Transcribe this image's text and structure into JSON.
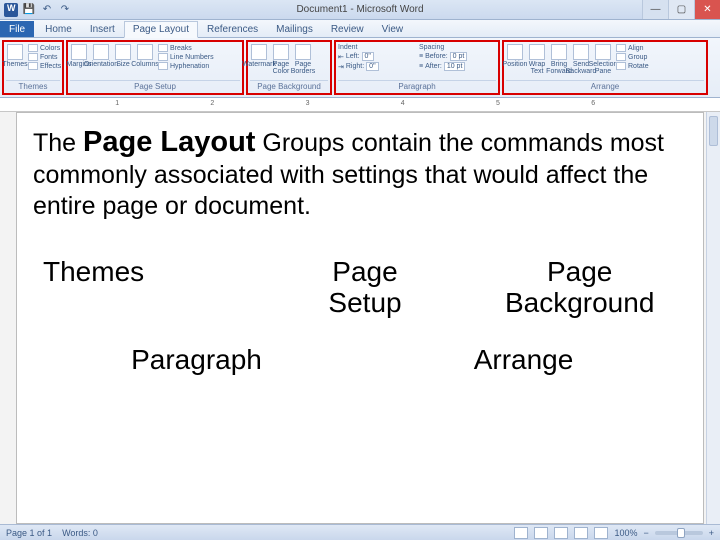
{
  "app": {
    "title": "Document1 - Microsoft Word"
  },
  "tabs": {
    "file": "File",
    "items": [
      "Home",
      "Insert",
      "Page Layout",
      "References",
      "Mailings",
      "Review",
      "View"
    ],
    "active": "Page Layout"
  },
  "ribbon": {
    "themes": {
      "name": "Themes",
      "main": "Themes",
      "colors": "Colors",
      "fonts": "Fonts",
      "effects": "Effects"
    },
    "pageSetup": {
      "name": "Page Setup",
      "margins": "Margins",
      "orientation": "Orientation",
      "size": "Size",
      "columns": "Columns",
      "breaks": "Breaks",
      "lineNumbers": "Line Numbers",
      "hyphenation": "Hyphenation"
    },
    "pageBackground": {
      "name": "Page Background",
      "watermark": "Watermark",
      "pageColor": "Page Color",
      "borders": "Page Borders"
    },
    "paragraph": {
      "name": "Paragraph",
      "indent": "Indent",
      "spacing": "Spacing",
      "left": "Left:",
      "right": "Right:",
      "before": "Before:",
      "after": "After:",
      "leftVal": "0\"",
      "rightVal": "0\"",
      "beforeVal": "0 pt",
      "afterVal": "10 pt"
    },
    "arrange": {
      "name": "Arrange",
      "position": "Position",
      "wrap": "Wrap Text",
      "bringFwd": "Bring Forward",
      "sendBack": "Send Backward",
      "selection": "Selection Pane",
      "align": "Align",
      "group": "Group",
      "rotate": "Rotate"
    }
  },
  "ruler": {
    "marks": [
      "1",
      "2",
      "3",
      "4",
      "5",
      "6"
    ]
  },
  "document": {
    "paragraph_pre": "The ",
    "paragraph_bold": "Page Layout",
    "paragraph_post": " Groups contain the commands most commonly associated with settings that would affect the entire page or document.",
    "row1": {
      "a": "Themes",
      "b": "Page\nSetup",
      "c": "Page\nBackground"
    },
    "row2": {
      "a": "Paragraph",
      "b": "Arrange"
    }
  },
  "status": {
    "page": "Page 1 of 1",
    "words": "Words: 0",
    "zoom": "100%"
  }
}
